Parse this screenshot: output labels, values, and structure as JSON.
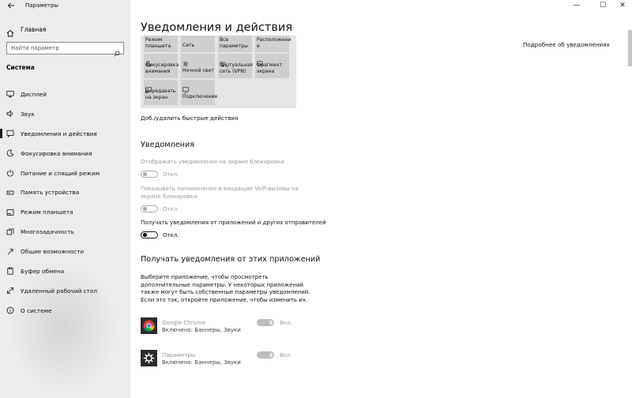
{
  "window": {
    "title": "Параметры",
    "minimize_glyph": "—",
    "maximize_glyph": "☐",
    "close_glyph": "✕"
  },
  "sidebar": {
    "home_label": "Главная",
    "search_placeholder": "Найти параметр",
    "section_label": "Система",
    "items": [
      {
        "label": "Дисплей",
        "icon": "display-icon"
      },
      {
        "label": "Звук",
        "icon": "sound-icon"
      },
      {
        "label": "Уведомления и действия",
        "icon": "notifications-icon",
        "active": true
      },
      {
        "label": "Фокусировка внимания",
        "icon": "moon-icon"
      },
      {
        "label": "Питание и спящий режим",
        "icon": "power-icon"
      },
      {
        "label": "Память устройства",
        "icon": "storage-icon"
      },
      {
        "label": "Режим планшета",
        "icon": "tablet-icon"
      },
      {
        "label": "Многозадачность",
        "icon": "multitasking-icon"
      },
      {
        "label": "Общие возможности",
        "icon": "shared-icon"
      },
      {
        "label": "Буфер обмена",
        "icon": "clipboard-icon"
      },
      {
        "label": "Удаленный рабочий стол",
        "icon": "remote-desktop-icon"
      },
      {
        "label": "О системе",
        "icon": "info-icon"
      }
    ]
  },
  "main": {
    "title": "Уведомления и действия",
    "related_link": "Подробнее об уведомлениях",
    "quick_actions": {
      "tiles": [
        {
          "label": "Режим\nпланшета",
          "icon": "",
          "row": 0,
          "col": 0
        },
        {
          "label": "Сеть",
          "icon": "",
          "row": 0,
          "col": 1
        },
        {
          "label": "Все\nпараметры",
          "icon": "",
          "row": 0,
          "col": 2
        },
        {
          "label": "Расположени\nе",
          "icon": "",
          "row": 0,
          "col": 3
        },
        {
          "label": "Фокусировка\nвнимания",
          "icon": "moon-icon",
          "row": 1,
          "col": 0
        },
        {
          "label": "Ночной свет",
          "icon": "sun-icon",
          "row": 1,
          "col": 1
        },
        {
          "label": "Виртуальная\nсеть (VPN)",
          "icon": "vpn-icon",
          "row": 1,
          "col": 2
        },
        {
          "label": "Фрагмент\nэкрана",
          "icon": "snip-icon",
          "row": 1,
          "col": 3
        },
        {
          "label": "Передавать\nна экран",
          "icon": "project-icon",
          "row": 2,
          "col": 0
        },
        {
          "label": "Подключение",
          "icon": "connect-icon",
          "row": 2,
          "col": 1
        }
      ],
      "edit_link": "Доб./удалить быстрые действия"
    },
    "notifications": {
      "heading": "Уведомления",
      "lock_screen_label": "Отображать уведомления на экране блокировки",
      "lock_screen_state": "Откл.",
      "voip_label": "Показывать напоминания и входящие VoIP-вызовы на экране блокировки",
      "voip_state": "Откл.",
      "apps_label": "Получать уведомления от приложений и других отправителей",
      "apps_state": "Откл."
    },
    "from_apps": {
      "heading": "Получать уведомления от этих приложений",
      "description": "Выберите приложение, чтобы просмотреть дополнительные параметры. У некоторых приложений также могут быть собственные параметры уведомлений. Если это так, откройте приложение, чтобы изменить их.",
      "apps": [
        {
          "name": "Google Chrome",
          "sub": "Включено: Баннеры, Звуки",
          "state": "Вкл.",
          "icon": "chrome-icon"
        },
        {
          "name": "Параметры",
          "sub": "Включено: Баннеры, Звуки",
          "state": "Вкл.",
          "icon": "settings-gear-icon"
        }
      ]
    }
  }
}
